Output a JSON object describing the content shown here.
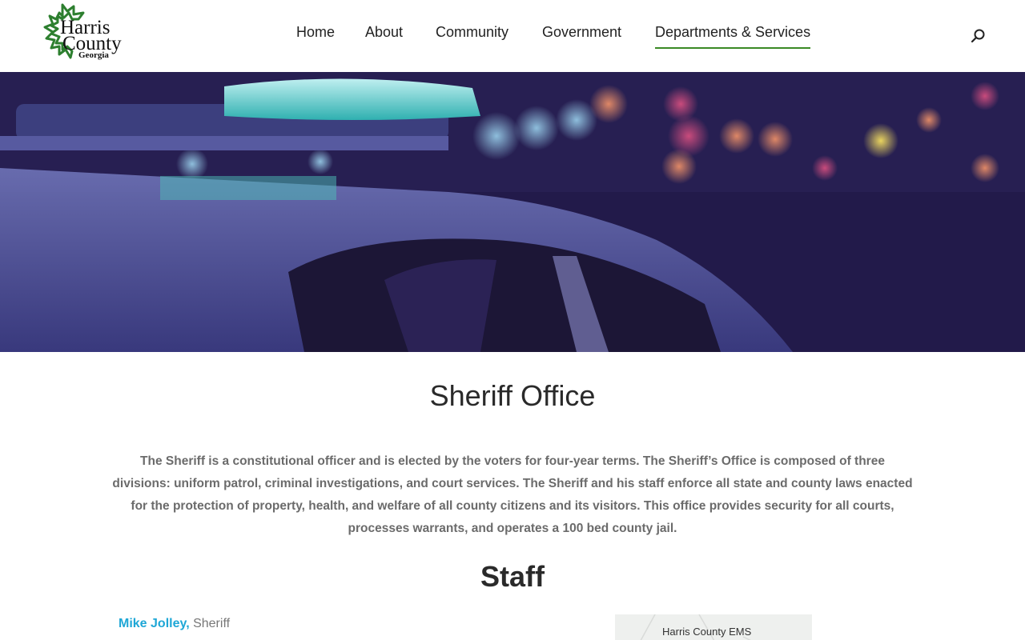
{
  "logo": {
    "line1": "Harris",
    "line2": "County",
    "line3": "Georgia"
  },
  "nav": {
    "items": [
      {
        "label": "Home"
      },
      {
        "label": "About"
      },
      {
        "label": "Community"
      },
      {
        "label": "Government"
      },
      {
        "label": "Departments & Services",
        "active": true
      }
    ]
  },
  "search": {
    "icon": "search-icon"
  },
  "colors": {
    "accent_green": "#3a8a24",
    "link_blue": "#1fa7d6"
  },
  "main": {
    "title": "Sheriff Office",
    "intro": "The Sheriff is a constitutional officer and is elected by the voters for four-year terms. The Sheriff’s Office is composed of three divisions: uniform patrol, criminal investigations, and court services. The Sheriff and his staff enforce all state and county laws enacted for the protection of property, health, and welfare of all county citizens and its visitors. This office provides security for all courts, processes warrants, and operates a 100 bed county jail.",
    "staff_heading": "Staff",
    "staff": [
      {
        "name": "Mike Jolley,",
        "role": " Sheriff"
      }
    ]
  },
  "map": {
    "label": "Harris County EMS"
  }
}
